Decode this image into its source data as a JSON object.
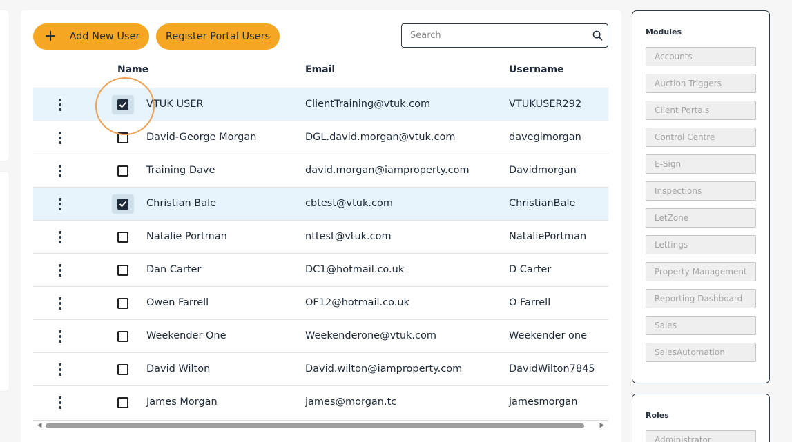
{
  "toolbar": {
    "add_user_icon": "+",
    "add_user_label": "Add New User",
    "register_label": "Register Portal Users",
    "search_placeholder": "Search"
  },
  "table": {
    "columns": {
      "name": "Name",
      "email": "Email",
      "username": "Username"
    },
    "rows": [
      {
        "name": "VTUK USER",
        "email": "ClientTraining@vtuk.com",
        "username": "VTUKUSER292",
        "checked": true
      },
      {
        "name": "David-George Morgan",
        "email": "DGL.david.morgan@vtuk.com",
        "username": "daveglmorgan",
        "checked": false
      },
      {
        "name": "Training Dave",
        "email": "david.morgan@iamproperty.com",
        "username": "Davidmorgan",
        "checked": false
      },
      {
        "name": "Christian Bale",
        "email": "cbtest@vtuk.com",
        "username": "ChristianBale",
        "checked": true
      },
      {
        "name": "Natalie Portman",
        "email": "nttest@vtuk.com",
        "username": "NataliePortman",
        "checked": false
      },
      {
        "name": "Dan Carter",
        "email": "DC1@hotmail.co.uk",
        "username": "D Carter",
        "checked": false
      },
      {
        "name": "Owen Farrell",
        "email": "OF12@hotmail.co.uk",
        "username": "O Farrell",
        "checked": false
      },
      {
        "name": "Weekender One",
        "email": "Weekenderone@vtuk.com",
        "username": "Weekender one",
        "checked": false
      },
      {
        "name": "David Wilton",
        "email": "David.wilton@iamproperty.com",
        "username": "DavidWilton7845",
        "checked": false
      },
      {
        "name": "James Morgan",
        "email": "james@morgan.tc",
        "username": "jamesmorgan",
        "checked": false
      }
    ]
  },
  "modules": {
    "title": "Modules",
    "items": [
      "Accounts",
      "Auction Triggers",
      "Client Portals",
      "Control Centre",
      "E-Sign",
      "Inspections",
      "LetZone",
      "Lettings",
      "Property Management",
      "Reporting Dashboard",
      "Sales",
      "SalesAutomation"
    ]
  },
  "roles": {
    "title": "Roles",
    "items": [
      "Administrator"
    ]
  },
  "colors": {
    "accent": "#f5a623",
    "selected_row": "#e7f3fa",
    "highlight_ring": "#f0a050"
  }
}
